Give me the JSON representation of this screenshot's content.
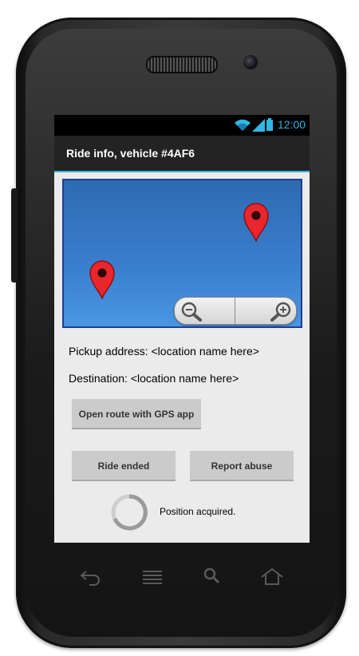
{
  "statusbar": {
    "time": "12:00"
  },
  "actionbar": {
    "title": "Ride info, vehicle #4AF6"
  },
  "map": {
    "pins": [
      "map-pin",
      "map-pin"
    ],
    "zoom_out_icon": "zoom-out-icon",
    "zoom_in_icon": "zoom-in-icon"
  },
  "details": {
    "pickup": "Pickup address: <location name here>",
    "destination": "Destination: <location name here>"
  },
  "buttons": {
    "gps": "Open route with GPS app",
    "ride_ended": "Ride ended",
    "report_abuse": "Report abuse"
  },
  "status": {
    "text": "Position acquired."
  },
  "colors": {
    "accent": "#33b5e5",
    "map": "#3a7fcf",
    "pin": "#e8262c"
  },
  "hardware_keys": [
    "back-icon",
    "menu-icon",
    "search-icon",
    "home-icon"
  ]
}
